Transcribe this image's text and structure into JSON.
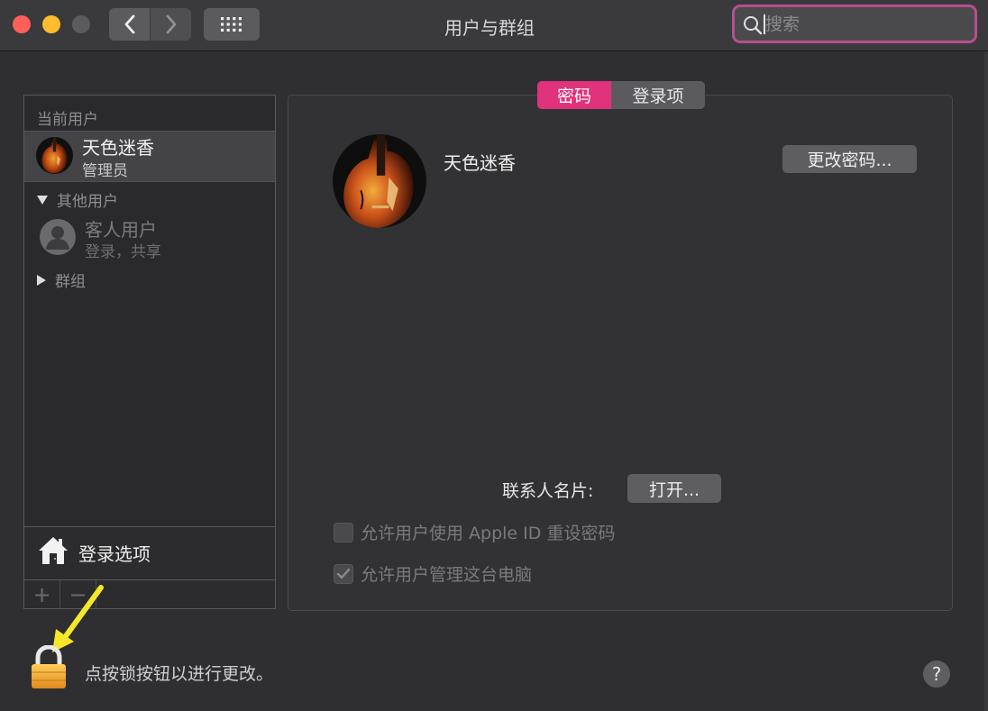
{
  "window": {
    "title": "用户与群组",
    "search_placeholder": "搜索"
  },
  "sidebar": {
    "current_users_label": "当前用户",
    "current_user": {
      "name": "天色迷香",
      "role": "管理员"
    },
    "other_users_label": "其他用户",
    "guest_user": {
      "name": "客人用户",
      "sub": "登录，共享"
    },
    "groups_label": "群组",
    "login_options_label": "登录选项",
    "add_label": "+",
    "remove_label": "−"
  },
  "tabs": [
    {
      "label": "密码",
      "active": true
    },
    {
      "label": "登录项",
      "active": false
    }
  ],
  "main": {
    "username": "天色迷香",
    "change_password_label": "更改密码...",
    "contact_card_label": "联系人名片:",
    "open_label": "打开...",
    "allow_reset_label": "允许用户使用 Apple ID 重设密码",
    "allow_reset_checked": false,
    "allow_admin_label": "允许用户管理这台电脑",
    "allow_admin_checked": true
  },
  "footer": {
    "lock_text": "点按锁按钮以进行更改。",
    "help_label": "?"
  },
  "colors": {
    "accent_tab": "#e0337c",
    "search_focus": "#b84e8d",
    "close": "#fe5f57",
    "minimize": "#febc2e",
    "annotation_arrow": "#f5e72a"
  }
}
